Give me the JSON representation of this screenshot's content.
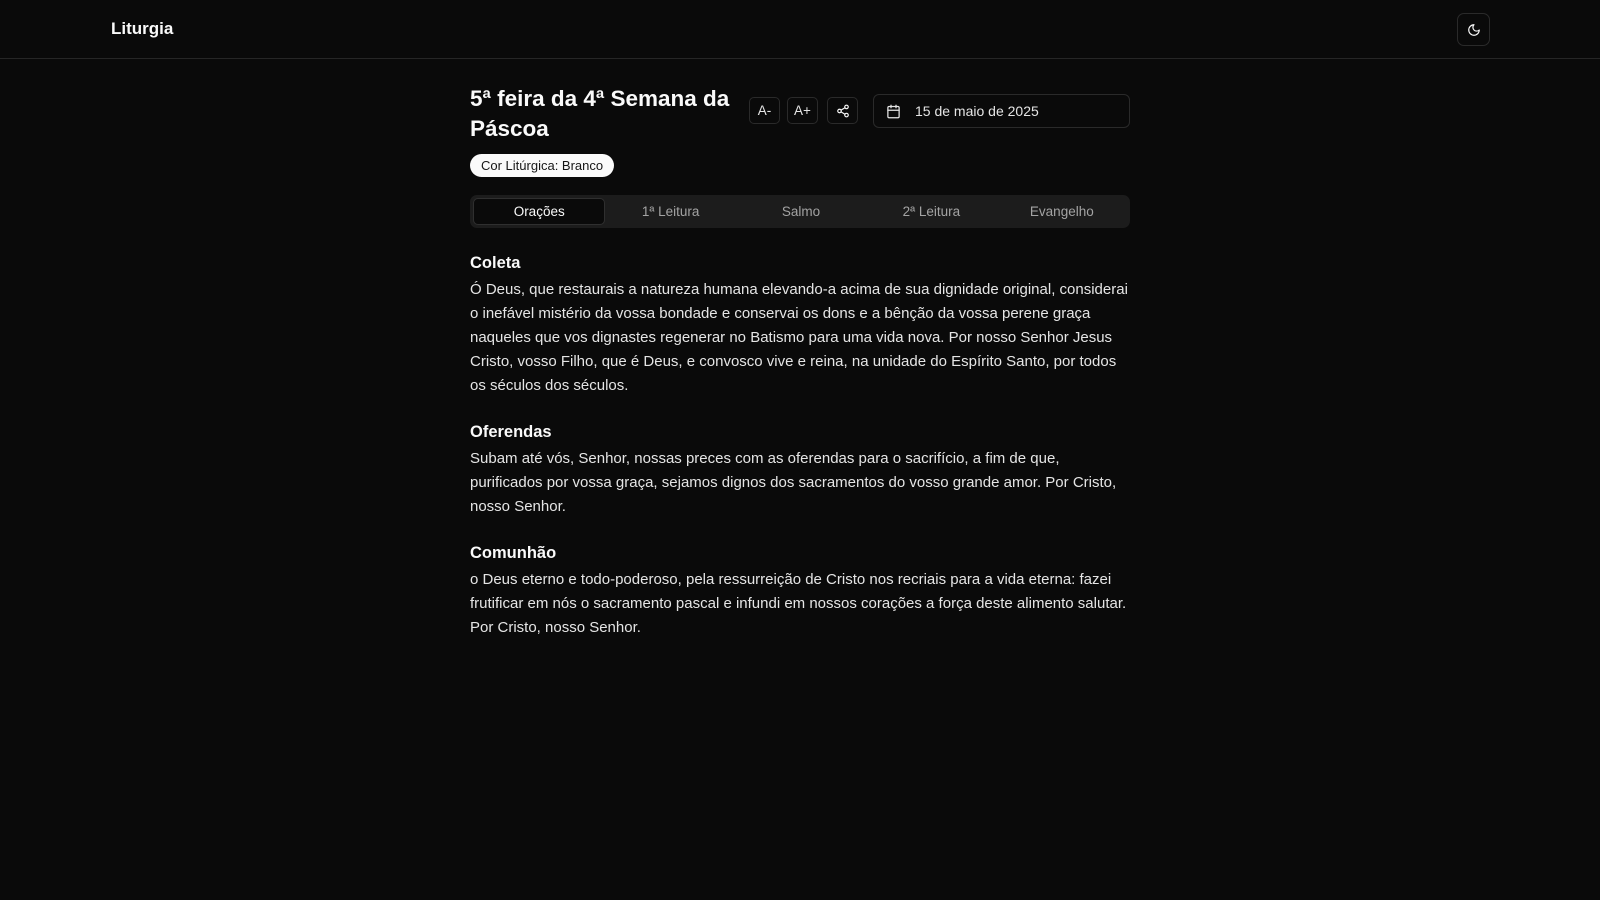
{
  "app": {
    "brand": "Liturgia",
    "theme_toggle_icon": "moon-icon"
  },
  "header": {
    "title": "5ª feira da 4ª Semana da Páscoa",
    "decrease_font_label": "A-",
    "increase_font_label": "A+",
    "share_icon": "share-icon",
    "calendar_icon": "calendar-icon",
    "date": "15 de maio de 2025"
  },
  "badge": {
    "label": "Cor Litúrgica: Branco"
  },
  "tabs": [
    {
      "label": "Orações",
      "active": true
    },
    {
      "label": "1ª Leitura",
      "active": false
    },
    {
      "label": "Salmo",
      "active": false
    },
    {
      "label": "2ª Leitura",
      "active": false
    },
    {
      "label": "Evangelho",
      "active": false
    }
  ],
  "sections": [
    {
      "title": "Coleta",
      "text": "Ó Deus, que restaurais a natureza humana elevando-a acima de sua dignidade original, considerai o inefável mistério da vossa bondade e conservai os dons e a bênção da vossa perene graça naqueles que vos dignastes regenerar no Batismo para uma vida nova. Por nosso Senhor Jesus Cristo, vosso Filho, que é Deus, e convosco vive e reina, na unidade do Espírito Santo, por todos os séculos dos séculos."
    },
    {
      "title": "Oferendas",
      "text": "Subam até vós, Senhor, nossas preces com as oferendas para o sacrifício, a fim de que, purificados por vossa graça, sejamos dignos dos sacramentos do vosso grande amor. Por Cristo, nosso Senhor."
    },
    {
      "title": "Comunhão",
      "text": "o Deus eterno e todo-poderoso, pela ressurreição de Cristo nos recriais para a vida eterna: fazei frutificar em nós o sacramento pascal e infundi em nossos corações a força deste alimento salutar. Por Cristo, nosso Senhor."
    }
  ],
  "colors": {
    "background": "#0a0a0a",
    "foreground": "#fafafa",
    "muted": "#a3a3a3",
    "border": "#2a2a2a",
    "badge_bg": "#fafafa",
    "badge_fg": "#171717"
  }
}
